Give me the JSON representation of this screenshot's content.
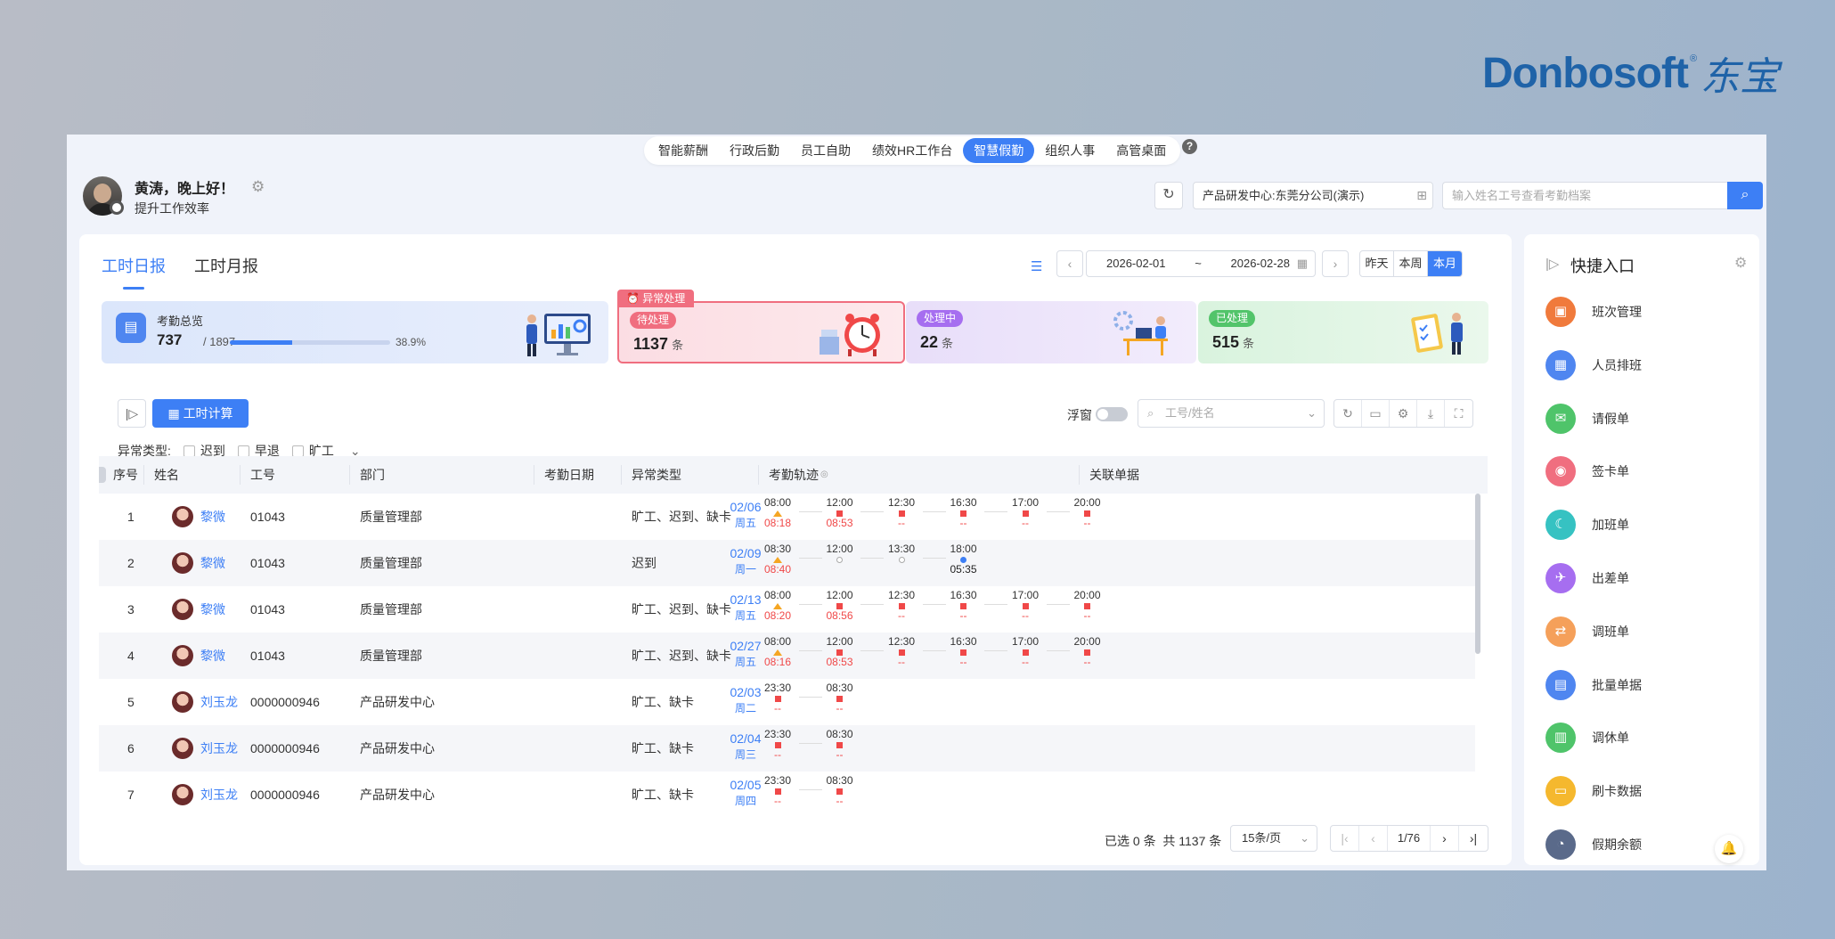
{
  "brand": {
    "word": "Donbosoft",
    "reg": "®",
    "cn": "东宝"
  },
  "topnav": {
    "items": [
      {
        "label": "智能薪酬",
        "active": false
      },
      {
        "label": "行政后勤",
        "active": false
      },
      {
        "label": "员工自助",
        "active": false
      },
      {
        "label": "绩效HR工作台",
        "active": false
      },
      {
        "label": "智慧假勤",
        "active": true
      },
      {
        "label": "组织人事",
        "active": false
      },
      {
        "label": "高管桌面",
        "active": false
      }
    ],
    "help": "?"
  },
  "user": {
    "greeting": "黄涛，晚上好！",
    "subtitle": "提升工作效率"
  },
  "header": {
    "org": "产品研发中心:东莞分公司(演示)",
    "search_placeholder": "输入姓名工号查看考勤档案"
  },
  "tabs": [
    {
      "label": "工时日报",
      "active": true
    },
    {
      "label": "工时月报",
      "active": false
    }
  ],
  "daterange": {
    "start": "2026-02-01",
    "sep": "~",
    "end": "2026-02-28"
  },
  "range_buttons": [
    {
      "label": "昨天",
      "active": false
    },
    {
      "label": "本周",
      "active": false
    },
    {
      "label": "本月",
      "active": true
    }
  ],
  "stats": {
    "overview": {
      "title": "考勤总览",
      "value": "737",
      "total": "/ 1897",
      "percent": "38.9%",
      "progress": 0.389
    },
    "anomaly_tag": "异常处理",
    "pending": {
      "pill": "待处理",
      "value": "1137",
      "unit": "条",
      "color": "#f06e7f"
    },
    "processing": {
      "pill": "处理中",
      "value": "22",
      "unit": "条",
      "color": "#a66ef0"
    },
    "done": {
      "pill": "已处理",
      "value": "515",
      "unit": "条",
      "color": "#52c46a"
    }
  },
  "toolbar": {
    "calc_label": "工时计算",
    "float_label": "浮窗",
    "search_placeholder": "工号/姓名"
  },
  "filter": {
    "label": "异常类型:",
    "options": [
      "迟到",
      "早退",
      "旷工"
    ]
  },
  "table": {
    "headers": [
      "序号",
      "姓名",
      "工号",
      "部门",
      "考勤日期",
      "异常类型",
      "考勤轨迹",
      "关联单据"
    ],
    "rows": [
      {
        "no": "1",
        "name": "黎微",
        "id": "01043",
        "dept": "质量管理部",
        "date": "02/06",
        "weekday": "周五",
        "type": "旷工、迟到、缺卡",
        "track": [
          {
            "t": "08:00",
            "m": "tri",
            "v": "08:18"
          },
          {
            "t": "12:00",
            "m": "sq",
            "v": "08:53"
          },
          {
            "t": "12:30",
            "m": "sq",
            "v": "--"
          },
          {
            "t": "16:30",
            "m": "sq",
            "v": "--"
          },
          {
            "t": "17:00",
            "m": "sq",
            "v": "--"
          },
          {
            "t": "20:00",
            "m": "sq",
            "v": "--"
          }
        ]
      },
      {
        "no": "2",
        "name": "黎微",
        "id": "01043",
        "dept": "质量管理部",
        "date": "02/09",
        "weekday": "周一",
        "type": "迟到",
        "track": [
          {
            "t": "08:30",
            "m": "tri",
            "v": "08:40"
          },
          {
            "t": "12:00",
            "m": "ring",
            "v": ""
          },
          {
            "t": "13:30",
            "m": "ring",
            "v": ""
          },
          {
            "t": "18:00",
            "m": "dot",
            "v": "05:35"
          }
        ]
      },
      {
        "no": "3",
        "name": "黎微",
        "id": "01043",
        "dept": "质量管理部",
        "date": "02/13",
        "weekday": "周五",
        "type": "旷工、迟到、缺卡",
        "track": [
          {
            "t": "08:00",
            "m": "tri",
            "v": "08:20"
          },
          {
            "t": "12:00",
            "m": "sq",
            "v": "08:56"
          },
          {
            "t": "12:30",
            "m": "sq",
            "v": "--"
          },
          {
            "t": "16:30",
            "m": "sq",
            "v": "--"
          },
          {
            "t": "17:00",
            "m": "sq",
            "v": "--"
          },
          {
            "t": "20:00",
            "m": "sq",
            "v": "--"
          }
        ]
      },
      {
        "no": "4",
        "name": "黎微",
        "id": "01043",
        "dept": "质量管理部",
        "date": "02/27",
        "weekday": "周五",
        "type": "旷工、迟到、缺卡",
        "track": [
          {
            "t": "08:00",
            "m": "tri",
            "v": "08:16"
          },
          {
            "t": "12:00",
            "m": "sq",
            "v": "08:53"
          },
          {
            "t": "12:30",
            "m": "sq",
            "v": "--"
          },
          {
            "t": "16:30",
            "m": "sq",
            "v": "--"
          },
          {
            "t": "17:00",
            "m": "sq",
            "v": "--"
          },
          {
            "t": "20:00",
            "m": "sq",
            "v": "--"
          }
        ]
      },
      {
        "no": "5",
        "name": "刘玉龙",
        "id": "0000000946",
        "dept": "产品研发中心",
        "date": "02/03",
        "weekday": "周二",
        "type": "旷工、缺卡",
        "track": [
          {
            "t": "23:30",
            "m": "sq",
            "v": "--"
          },
          {
            "t": "08:30",
            "m": "sq",
            "v": "--"
          }
        ]
      },
      {
        "no": "6",
        "name": "刘玉龙",
        "id": "0000000946",
        "dept": "产品研发中心",
        "date": "02/04",
        "weekday": "周三",
        "type": "旷工、缺卡",
        "track": [
          {
            "t": "23:30",
            "m": "sq",
            "v": "--"
          },
          {
            "t": "08:30",
            "m": "sq",
            "v": "--"
          }
        ]
      },
      {
        "no": "7",
        "name": "刘玉龙",
        "id": "0000000946",
        "dept": "产品研发中心",
        "date": "02/05",
        "weekday": "周四",
        "type": "旷工、缺卡",
        "track": [
          {
            "t": "23:30",
            "m": "sq",
            "v": "--"
          },
          {
            "t": "08:30",
            "m": "sq",
            "v": "--"
          }
        ]
      }
    ]
  },
  "pager": {
    "selected": "已选 0 条",
    "total": "共 1137 条",
    "page_size": "15条/页",
    "page": "1/76"
  },
  "quick": {
    "title": "快捷入口",
    "items": [
      {
        "label": "班次管理",
        "color": "#f07a3c"
      },
      {
        "label": "人员排班",
        "color": "#4f86f0"
      },
      {
        "label": "请假单",
        "color": "#4fc46a"
      },
      {
        "label": "签卡单",
        "color": "#f06e7f"
      },
      {
        "label": "加班单",
        "color": "#36c2c2"
      },
      {
        "label": "出差单",
        "color": "#a66ef0"
      },
      {
        "label": "调班单",
        "color": "#f5a05a"
      },
      {
        "label": "批量单据",
        "color": "#4f86f0"
      },
      {
        "label": "调休单",
        "color": "#4fc46a"
      },
      {
        "label": "刷卡数据",
        "color": "#f5b82e"
      },
      {
        "label": "假期余额",
        "color": "#5a6a8a"
      }
    ]
  }
}
